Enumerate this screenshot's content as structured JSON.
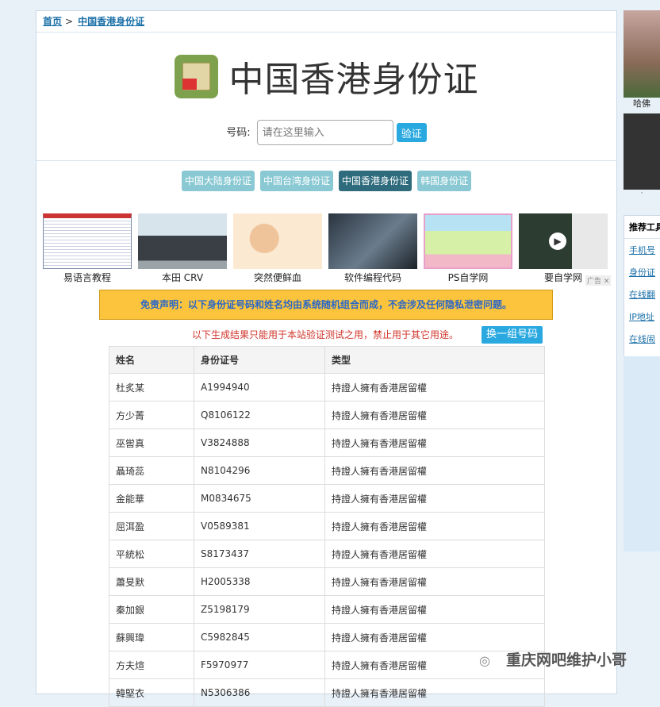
{
  "breadcrumb": {
    "home": "首页",
    "sep": ">",
    "current": "中国香港身份证"
  },
  "title": "中国香港身份证",
  "form": {
    "label": "号码:",
    "placeholder": "请在这里输入",
    "button": "验证"
  },
  "tabs": [
    {
      "label": "中国大陆身份证",
      "active": false
    },
    {
      "label": "中国台湾身份证",
      "active": false
    },
    {
      "label": "中国香港身份证",
      "active": true
    },
    {
      "label": "韩国身份证",
      "active": false
    }
  ],
  "ads": [
    "易语言教程",
    "本田 CRV",
    "突然便鲜血",
    "软件编程代码",
    "PS自学网",
    "要自学网"
  ],
  "ad_tag": "广告",
  "notice": "免责声明：以下身份证号码和姓名均由系统随机组合而成，不会涉及任何隐私泄密问题。",
  "subnote": "以下生成结果只能用于本站验证测试之用，禁止用于其它用途。",
  "swap_button": "换一组号码",
  "table": {
    "headers": [
      "姓名",
      "身份证号",
      "类型"
    ],
    "rows": [
      [
        "杜炙某",
        "A1994940",
        "持證人擁有香港居留權"
      ],
      [
        "方少菁",
        "Q8106122",
        "持證人擁有香港居留權"
      ],
      [
        "巫喾真",
        "V3824888",
        "持證人擁有香港居留權"
      ],
      [
        "聶琦蕊",
        "N8104296",
        "持證人擁有香港居留權"
      ],
      [
        "金能華",
        "M0834675",
        "持證人擁有香港居留權"
      ],
      [
        "屈洱盈",
        "V0589381",
        "持證人擁有香港居留權"
      ],
      [
        "平統松",
        "S8173437",
        "持證人擁有香港居留權"
      ],
      [
        "蕭旻默",
        "H2005338",
        "持證人擁有香港居留權"
      ],
      [
        "秦加銀",
        "Z5198179",
        "持證人擁有香港居留權"
      ],
      [
        "蘇興瑋",
        "C5982845",
        "持證人擁有香港居留權"
      ],
      [
        "方夫煊",
        "F5970977",
        "持證人擁有香港居留權"
      ],
      [
        "韓堅衣",
        "N5306386",
        "持證人擁有香港居留權"
      ]
    ]
  },
  "right": {
    "pic_caption": "哈佛",
    "rec_title": "推荐工具",
    "rec_items": [
      "手机号",
      "身份证",
      "在线翻",
      "IP地址",
      "在线闹"
    ]
  },
  "watermark": "重庆网吧维护小哥",
  "colors": {
    "accent": "#2aa9e0",
    "tab": "#8ac9d3",
    "tab_active": "#2e6b7d",
    "notice_bg": "#fbc43c",
    "notice_text": "#2a67c8",
    "warning": "#d0352b"
  }
}
